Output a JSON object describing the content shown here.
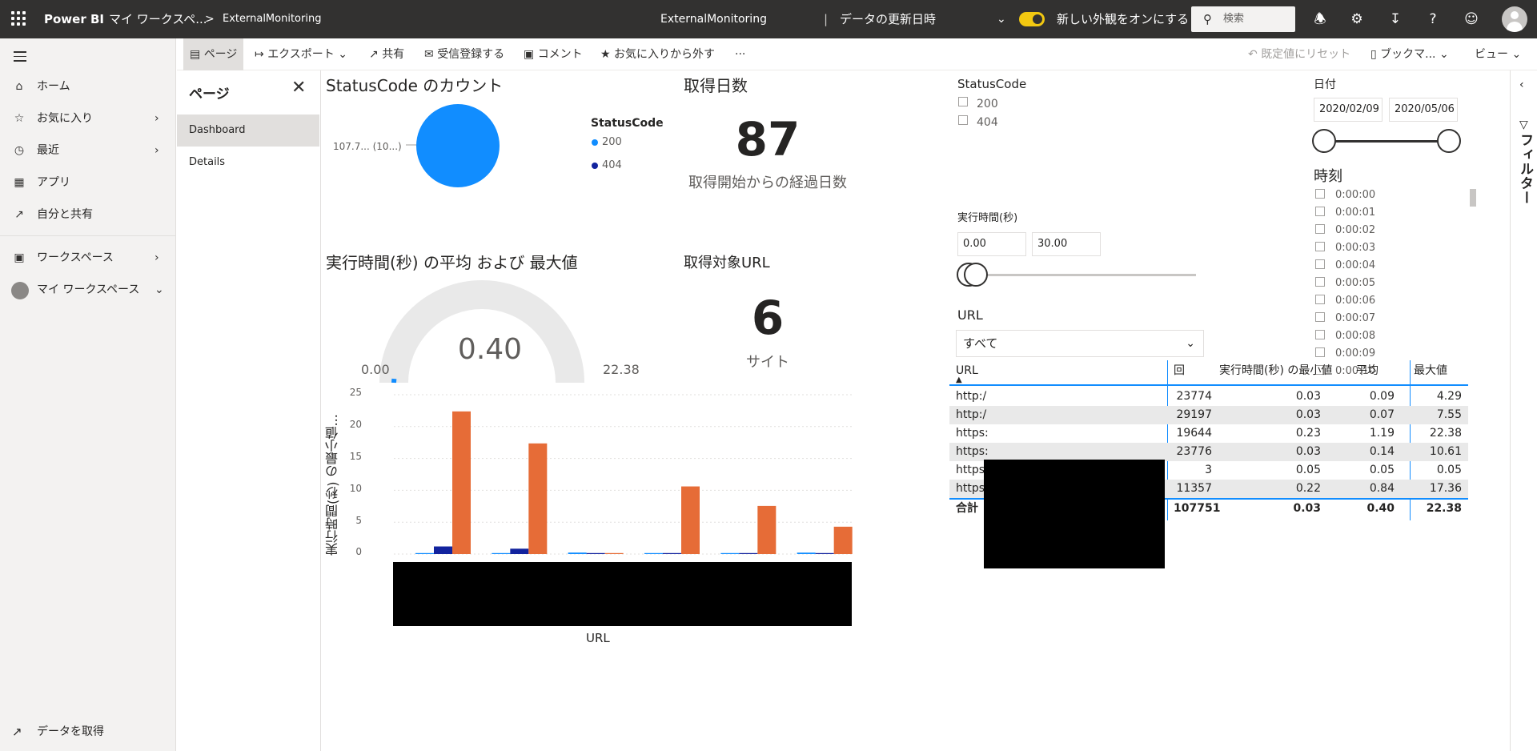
{
  "topbar": {
    "brand": "Power BI",
    "workspace": "マイ ワークスペ...",
    "breadcrumb_sep": ">",
    "report": "ExternalMonitoring",
    "center_title": "ExternalMonitoring",
    "center_sep": "|",
    "refresh_label": "データの更新日時",
    "toggle_label": "新しい外観をオンにする",
    "search_placeholder": "検索"
  },
  "leftnav": {
    "items": [
      {
        "label": "ホーム",
        "icon": "home-icon"
      },
      {
        "label": "お気に入り",
        "icon": "star-icon"
      },
      {
        "label": "最近",
        "icon": "clock-icon"
      },
      {
        "label": "アプリ",
        "icon": "apps-icon"
      },
      {
        "label": "自分と共有",
        "icon": "shared-icon"
      },
      {
        "label": "ワークスペース",
        "icon": "workspace-icon"
      },
      {
        "label": "マイ ワークスペース",
        "icon": "avatar-icon"
      }
    ],
    "get_data": "データを取得"
  },
  "actionbar": {
    "page": "ページ",
    "export": "エクスポート",
    "share": "共有",
    "subscribe": "受信登録する",
    "comment": "コメント",
    "unfavorite": "お気に入りから外す",
    "more": "···",
    "reset": "既定値にリセット",
    "bookmark": "ブックマ...",
    "view": "ビュー"
  },
  "pages_pane": {
    "title": "ページ",
    "pages": [
      "Dashboard",
      "Details"
    ]
  },
  "visuals": {
    "pie": {
      "title": "StatusCode のカウント",
      "slice_label": "107.7... (10...)",
      "legend_title": "StatusCode",
      "legend": [
        "200",
        "404"
      ]
    },
    "days_card": {
      "title": "取得日数",
      "value": "87",
      "label": "取得開始からの経過日数"
    },
    "gauge": {
      "title": "実行時間(秒) の平均 および 最大値",
      "value": "0.40",
      "min": "0.00",
      "max": "22.38"
    },
    "url_card": {
      "title": "取得対象URL",
      "value": "6",
      "label": "サイト"
    },
    "bar": {
      "ylabel": "実行時間(秒) の最小値...",
      "xlabel": "URL",
      "yticks": [
        "25",
        "20",
        "15",
        "10",
        "5",
        "0"
      ]
    }
  },
  "slicers": {
    "status": {
      "title": "StatusCode",
      "options": [
        "200",
        "404"
      ]
    },
    "date": {
      "title": "日付",
      "from": "2020/02/09",
      "to": "2020/05/06"
    },
    "time": {
      "title": "時刻",
      "options": [
        "0:00:00",
        "0:00:01",
        "0:00:02",
        "0:00:03",
        "0:00:04",
        "0:00:05",
        "0:00:06",
        "0:00:07",
        "0:00:08",
        "0:00:09",
        "0:00:10"
      ]
    },
    "exec": {
      "title": "実行時間(秒)",
      "from": "0.00",
      "to": "30.00"
    },
    "url": {
      "title": "URL",
      "value": "すべて"
    }
  },
  "table": {
    "headers": [
      "URL",
      "回",
      "実行時間(秒) の最小値",
      "平均",
      "最大値"
    ],
    "rows": [
      {
        "url": "http:/",
        "count": "23774",
        "min": "0.03",
        "avg": "0.09",
        "max": "4.29"
      },
      {
        "url": "http:/",
        "count": "29197",
        "min": "0.03",
        "avg": "0.07",
        "max": "7.55"
      },
      {
        "url": "https:",
        "count": "19644",
        "min": "0.23",
        "avg": "1.19",
        "max": "22.38"
      },
      {
        "url": "https:",
        "count": "23776",
        "min": "0.03",
        "avg": "0.14",
        "max": "10.61"
      },
      {
        "url": "https:",
        "count": "3",
        "min": "0.05",
        "avg": "0.05",
        "max": "0.05"
      },
      {
        "url": "https:",
        "count": "11357",
        "min": "0.22",
        "avg": "0.84",
        "max": "17.36"
      }
    ],
    "total": {
      "label": "合計",
      "count": "107751",
      "min": "0.03",
      "avg": "0.40",
      "max": "22.38"
    }
  },
  "filters": {
    "label": "フィルター"
  },
  "colors": {
    "min_series": "#118dff",
    "avg_series": "#12239e",
    "max_series": "#e66c37",
    "accent_yellow": "#f2c811"
  },
  "chart_data": {
    "type": "bar",
    "categories": [
      "",
      "",
      "",
      "",
      "",
      ""
    ],
    "series": [
      {
        "values": [
          0.03,
          0.03,
          0.23,
          0.03,
          0.05,
          0.22
        ]
      },
      {
        "values": [
          1.19,
          0.84,
          0.09,
          0.14,
          0.05,
          0.07
        ]
      },
      {
        "values": [
          22.38,
          17.36,
          0.05,
          10.61,
          7.55,
          4.29
        ]
      }
    ],
    "ylabel": "実行時間(秒) の最小値...",
    "xlabel": "URL",
    "ylim": [
      0,
      25
    ],
    "grid": true
  }
}
